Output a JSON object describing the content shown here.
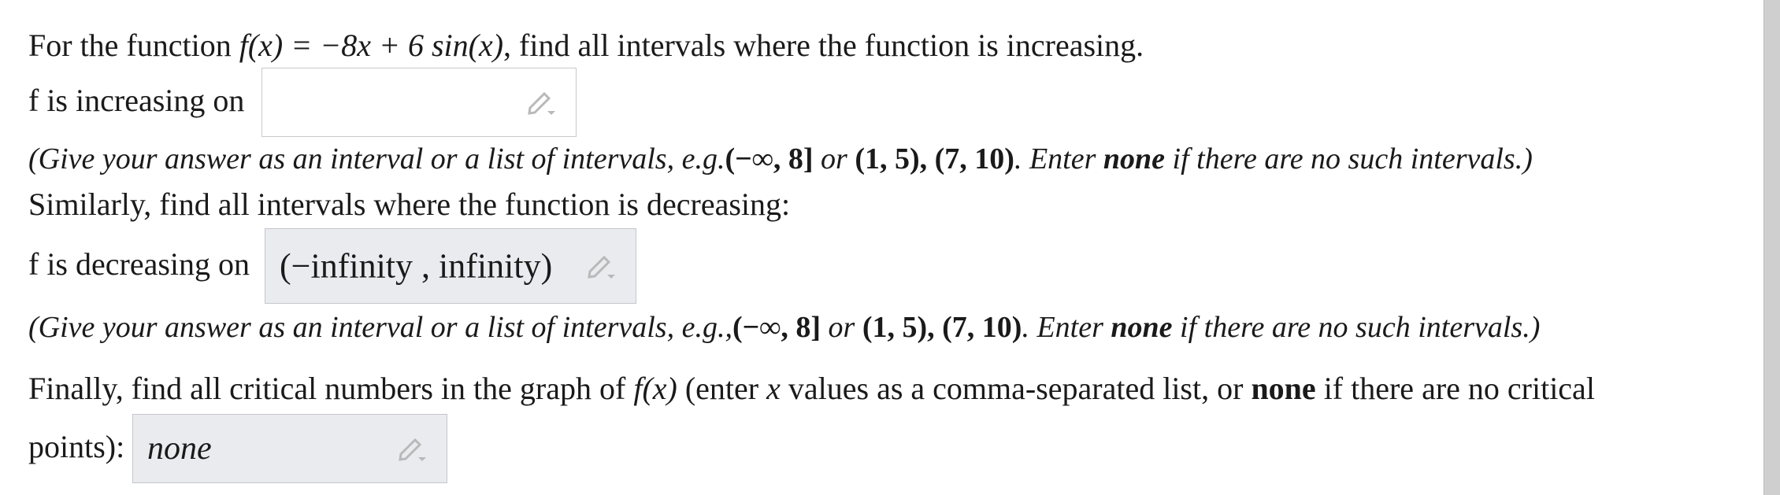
{
  "question": {
    "intro_prefix": "For the function ",
    "function_text": "f(x) = −8x + 6 sin(x)",
    "intro_suffix": ", find all intervals where the function is increasing."
  },
  "increasing": {
    "label": "f is increasing on",
    "value": ""
  },
  "hint1": {
    "text_a": "(Give your answer as an interval or a list of intervals, e.g.",
    "example1": "(−∞, 8]",
    "or": " or ",
    "example2": "(1, 5), (7, 10)",
    "text_b": ". Enter ",
    "none_word": "none",
    "text_c": " if there are no such intervals.)"
  },
  "decreasing_prompt": "Similarly, find all intervals where the function is decreasing:",
  "decreasing": {
    "label": "f is decreasing on",
    "value": "(−infinity , infinity)"
  },
  "hint2": {
    "text_a": "(Give your answer as an interval or a list of intervals, e.g.,",
    "example1": "(−∞, 8]",
    "or": " or ",
    "example2": "(1, 5), (7, 10)",
    "text_b": ". Enter ",
    "none_word": "none",
    "text_c": " if there are no such intervals.)"
  },
  "critical": {
    "prompt_a": "Finally, find all critical numbers in the graph of ",
    "fx": "f(x)",
    "prompt_b": " (enter ",
    "x": "x",
    "prompt_c": " values as a comma-separated list, or ",
    "none_word": "none",
    "prompt_d": " if there are no critical",
    "line2": "points):",
    "value": "none"
  },
  "icons": {
    "edit": "pencil-icon"
  }
}
